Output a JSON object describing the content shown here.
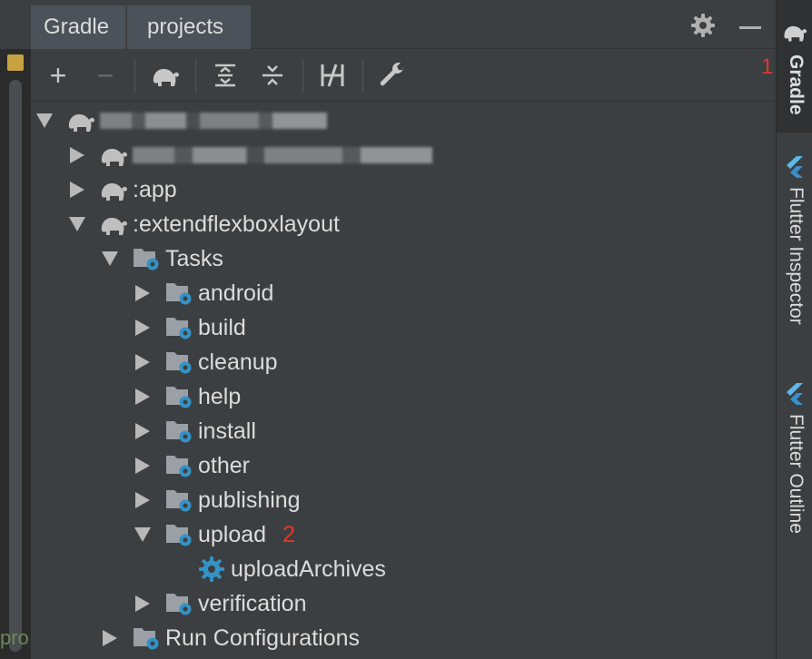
{
  "window": {
    "tabs": [
      {
        "label": "Gradle"
      },
      {
        "label": "projects"
      }
    ],
    "settings_icon": "gear-icon",
    "minimize_icon": "minus-icon"
  },
  "toolbar": {
    "add_label": "+",
    "remove_label": "−",
    "buttons": [
      "add-icon",
      "remove-icon",
      "gradle-elephant-icon",
      "expand-all-icon",
      "collapse-all-icon",
      "toggle-offline-icon",
      "build-settings-wrench-icon"
    ]
  },
  "tree": {
    "root": {
      "label": ""
    },
    "basemodule": {
      "label": ""
    },
    "app": {
      "label": ":app"
    },
    "extend": {
      "label": ":extendflexboxlayout"
    },
    "tasks": {
      "label": "Tasks"
    },
    "groups": [
      {
        "label": "android"
      },
      {
        "label": "build"
      },
      {
        "label": "cleanup"
      },
      {
        "label": "help"
      },
      {
        "label": "install"
      },
      {
        "label": "other"
      },
      {
        "label": "publishing"
      },
      {
        "label": "upload",
        "annotation": "2"
      },
      {
        "label": "verification"
      }
    ],
    "upload_task": {
      "label": "uploadArchives"
    },
    "run_configurations": {
      "label": "Run Configurations"
    }
  },
  "sidebar": {
    "gradle": {
      "label": "Gradle",
      "annotation": "1"
    },
    "flutter_inspector": {
      "label": "Flutter Inspector"
    },
    "flutter_outline": {
      "label": "Flutter Outline"
    }
  },
  "editor": {
    "visible_text": "pro"
  },
  "colors": {
    "background": "#3c3f41",
    "text": "#dcdcdc",
    "annotation": "#e5362b",
    "folder_gear": "#3592c4"
  }
}
